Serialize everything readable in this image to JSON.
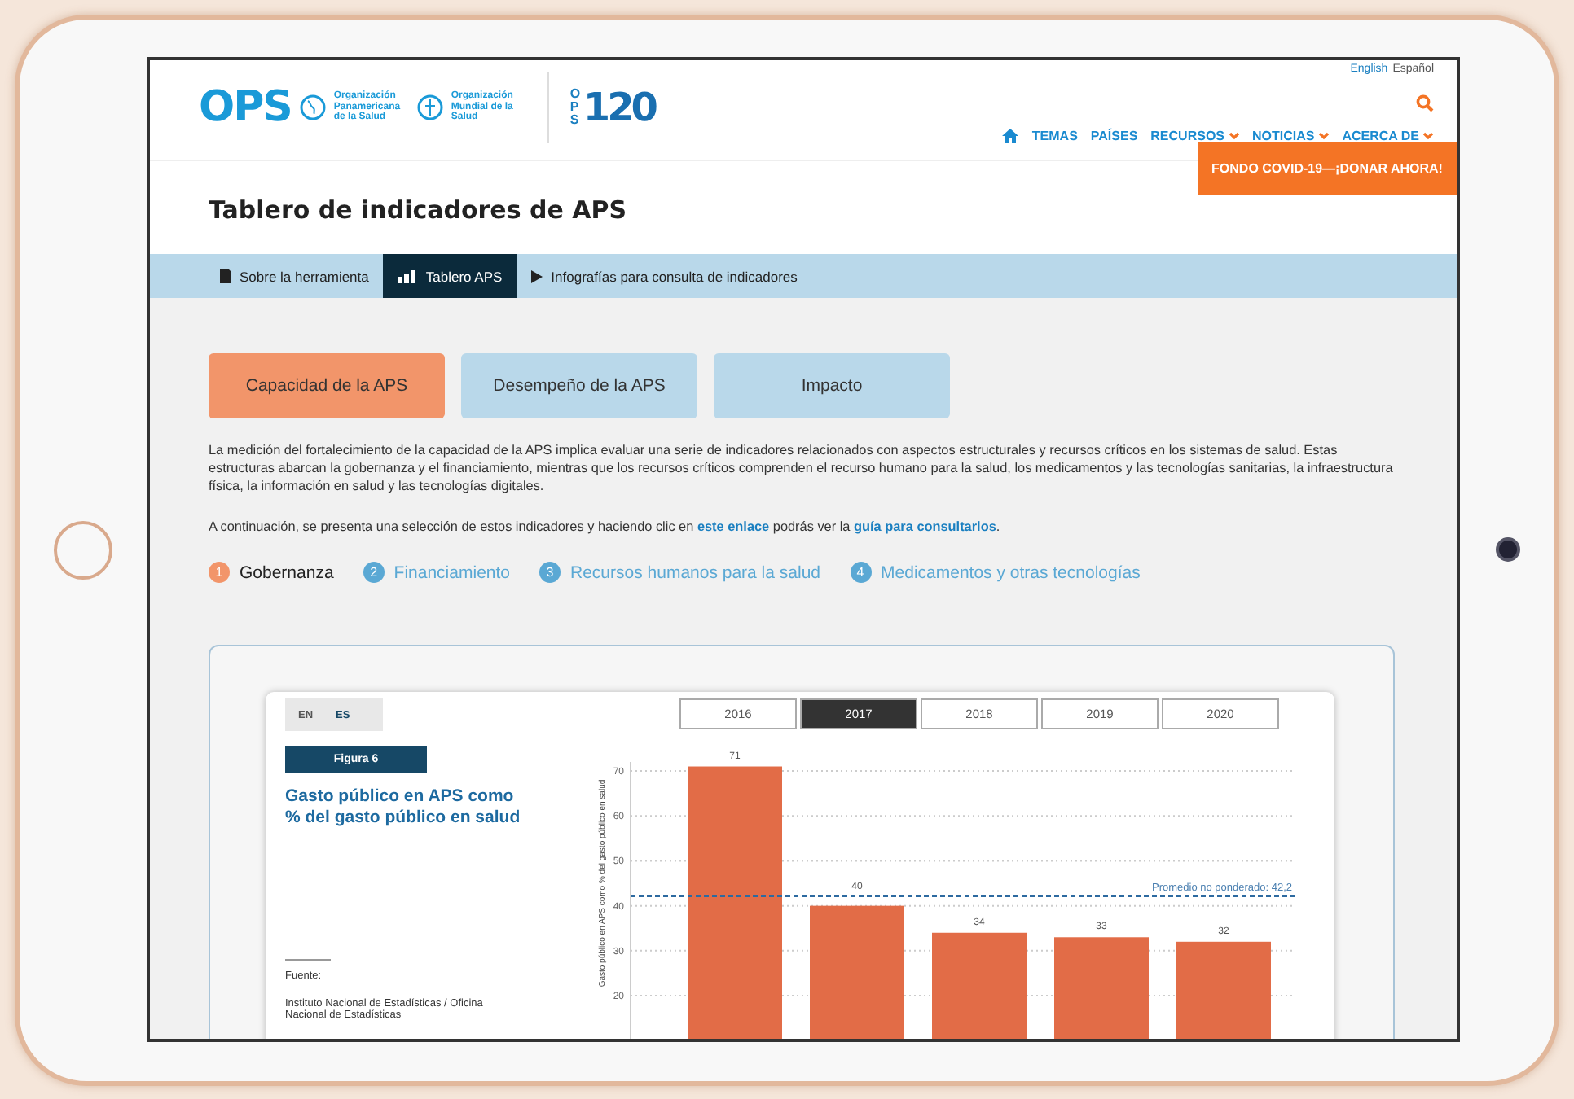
{
  "header": {
    "logo": {
      "acronym": "OPS",
      "paho_name": "Organización Panamericana de la Salud",
      "who_name": "Organización Mundial de la Salud",
      "anniversary_prefix": "OPS",
      "anniversary_number": "120"
    },
    "languages": [
      {
        "label": "English",
        "selected": false
      },
      {
        "label": "Español",
        "selected": true
      }
    ],
    "nav": [
      {
        "label": "TEMAS",
        "dropdown": false
      },
      {
        "label": "PAÍSES",
        "dropdown": false
      },
      {
        "label": "RECURSOS",
        "dropdown": true
      },
      {
        "label": "NOTICIAS",
        "dropdown": true
      },
      {
        "label": "ACERCA DE",
        "dropdown": true
      }
    ],
    "donate_button": "FONDO COVID-19—¡DONAR AHORA!"
  },
  "page_title": "Tablero de indicadores de APS",
  "subnav": [
    {
      "label": "Sobre la herramienta",
      "kind": "doc",
      "selected": false
    },
    {
      "label": "Tablero APS",
      "kind": "chart",
      "selected": true
    },
    {
      "label": "Infografías para consulta de indicadores",
      "kind": "play",
      "selected": false
    }
  ],
  "tabs": [
    {
      "label": "Capacidad de la APS",
      "selected": true
    },
    {
      "label": "Desempeño de la APS",
      "selected": false
    },
    {
      "label": "Impacto",
      "selected": false
    }
  ],
  "intro": "La medición del fortalecimiento de la capacidad de la APS implica evaluar una serie de indicadores relacionados con aspectos estructurales y recursos críticos en los sistemas de salud. Estas estructuras abarcan la gobernanza y el financiamiento, mientras que los recursos críticos comprenden el recurso humano para la salud, los medicamentos y las tecnologías sanitarias, la infraestructura física, la información en salud y las tecnologías digitales.",
  "guide": {
    "before": "A continuación, se presenta una selección de estos indicadores y haciendo clic en",
    "link1": "este enlace",
    "middle": "podrás ver la",
    "link2": "guía para consultarlos",
    "after": "."
  },
  "steps": [
    {
      "number": "1",
      "label": "Gobernanza",
      "selected": true
    },
    {
      "number": "2",
      "label": "Financiamiento",
      "selected": false
    },
    {
      "number": "3",
      "label": "Recursos humanos para la salud",
      "selected": false
    },
    {
      "number": "4",
      "label": "Medicamentos y otras tecnologías",
      "selected": false
    }
  ],
  "figure": {
    "languages": [
      {
        "label": "EN",
        "selected": false
      },
      {
        "label": "ES",
        "selected": true
      }
    ],
    "badge": "Figura 6",
    "title": "Gasto público en APS como % del gasto público en salud",
    "source_label": "Fuente:",
    "source": "Instituto Nacional de Estadísticas / Oficina Nacional de Estadísticas",
    "years": [
      {
        "label": "2016",
        "selected": false
      },
      {
        "label": "2017",
        "selected": true
      },
      {
        "label": "2018",
        "selected": false
      },
      {
        "label": "2019",
        "selected": false
      },
      {
        "label": "2020",
        "selected": false
      }
    ],
    "chart_data": {
      "type": "bar",
      "ylabel": "Gasto público en APS como % del gasto público en salud",
      "values": [
        71,
        40,
        34,
        33,
        32
      ],
      "ylim": [
        0,
        72
      ],
      "yticks": [
        20,
        30,
        40,
        50,
        60,
        70
      ],
      "grid": true,
      "data_labels": true,
      "ref_lines": [
        {
          "axis": "y",
          "value": 42.2,
          "label": "Promedio no ponderado: 42,2"
        }
      ]
    }
  }
}
